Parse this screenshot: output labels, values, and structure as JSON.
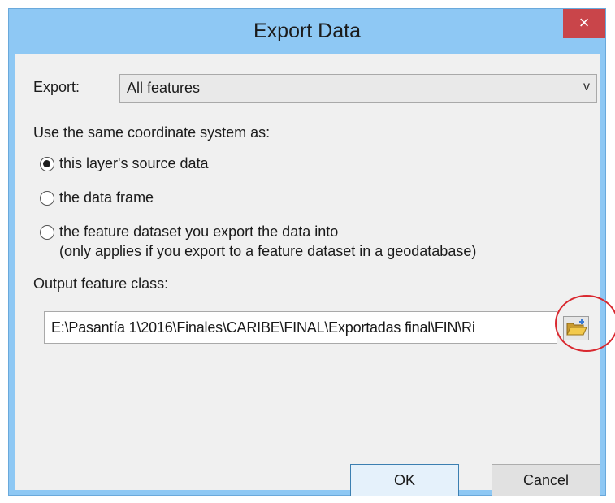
{
  "window": {
    "title": "Export Data",
    "close_label": "×"
  },
  "export": {
    "label": "Export:",
    "selected": "All features",
    "chevron": "v"
  },
  "coordinate": {
    "heading": "Use the same coordinate system as:",
    "options": [
      {
        "label": "this layer's source data",
        "selected": true
      },
      {
        "label": "the data frame",
        "selected": false
      },
      {
        "label": "the feature dataset you export the data into",
        "sub": "(only applies if you export to a feature dataset in a geodatabase)",
        "selected": false
      }
    ]
  },
  "output": {
    "label": "Output feature class:",
    "path": "E:\\Pasantía 1\\2016\\Finales\\CARIBE\\FINAL\\Exportadas final\\FIN\\Ri",
    "browse_icon": "folder-open-icon"
  },
  "buttons": {
    "ok": "OK",
    "cancel": "Cancel"
  },
  "colors": {
    "title_bar": "#8ec8f4",
    "close": "#c9454a",
    "highlight_circle": "#d9282f"
  }
}
